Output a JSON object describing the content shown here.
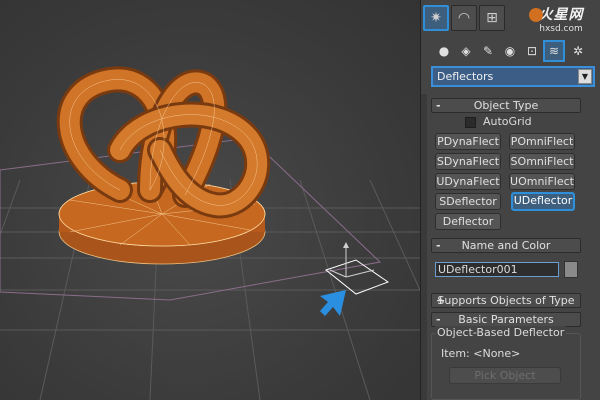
{
  "panel": {
    "tabs": [
      {
        "icon": "create-icon",
        "active": true
      },
      {
        "icon": "modify-icon",
        "active": false
      },
      {
        "icon": "hierarchy-icon",
        "active": false
      }
    ],
    "logo": {
      "title": "火星网",
      "subtitle": "hxsd.com"
    },
    "subtabs": [
      {
        "icon": "geometry-icon",
        "active": false
      },
      {
        "icon": "shapes-icon",
        "active": false
      },
      {
        "icon": "lights-icon",
        "active": false
      },
      {
        "icon": "cameras-icon",
        "active": false
      },
      {
        "icon": "helpers-icon",
        "active": false
      },
      {
        "icon": "space-warps-icon",
        "active": true
      },
      {
        "icon": "systems-icon",
        "active": false
      }
    ],
    "category_dropdown": "Deflectors",
    "object_type": {
      "header": "Object Type",
      "sign": "-",
      "autogrid_label": "AutoGrid",
      "buttons": [
        "PDynaFlect",
        "POmniFlect",
        "SDynaFlect",
        "SOmniFlect",
        "UDynaFlect",
        "UOmniFlect",
        "SDeflector",
        "UDeflector",
        "Deflector"
      ],
      "active_button": "UDeflector"
    },
    "name_and_color": {
      "header": "Name and Color",
      "sign": "-",
      "name_value": "UDeflector001",
      "color": "#8a8a8a"
    },
    "supports_objects": {
      "header": "Supports Objects of Type",
      "sign": "+"
    },
    "basic_parameters": {
      "header": "Basic Parameters",
      "sign": "-",
      "group_title": "Object-Based Deflector",
      "item_label": "Item: <None>",
      "pick_button": "Pick Object"
    }
  },
  "colors": {
    "accent": "#2f8fd8",
    "mesh_orange": "#c8641e",
    "arrow_blue": "#2a8fe0"
  }
}
